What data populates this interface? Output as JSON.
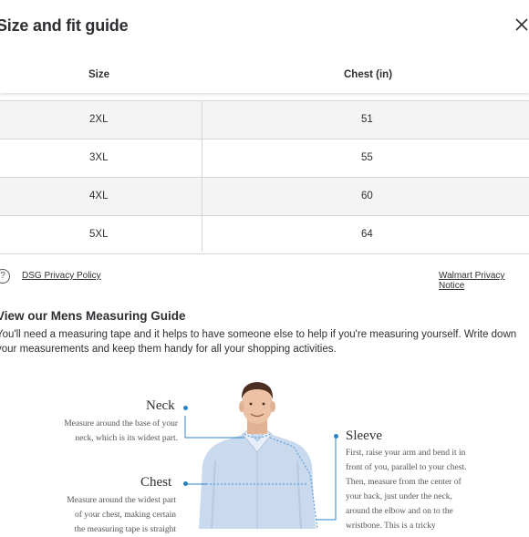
{
  "modal": {
    "title": "Size and fit guide"
  },
  "table": {
    "headers": [
      "Size",
      "Chest (in)"
    ],
    "rows": [
      [
        "2XL",
        "51"
      ],
      [
        "3XL",
        "55"
      ],
      [
        "4XL",
        "60"
      ],
      [
        "5XL",
        "64"
      ]
    ]
  },
  "links": {
    "help_icon": "question-circle-icon",
    "dsg": "DSG Privacy Policy",
    "walmart": "Walmart Privacy Notice"
  },
  "guide": {
    "title": "View our Mens Measuring Guide",
    "intro": "You'll need a measuring tape and it helps to have someone else to help if you're measuring yourself. Write down your measurements and keep them handy for all your shopping activities.",
    "neck": {
      "label": "Neck",
      "text": [
        "Measure around the base of your",
        "neck, which is its widest part."
      ]
    },
    "chest": {
      "label": "Chest",
      "text": [
        "Measure around the widest part",
        "of your chest, making certain",
        "the measuring tape is straight"
      ]
    },
    "sleeve": {
      "label": "Sleeve",
      "text": [
        "First, raise your arm and bend it in",
        "front of you, parallel to your chest.",
        "Then, measure from the center of",
        "your back, just under the neck,",
        "around the elbow and on to the",
        "wristbone. This is a tricky"
      ]
    },
    "accent_color": "#2b83c4"
  }
}
